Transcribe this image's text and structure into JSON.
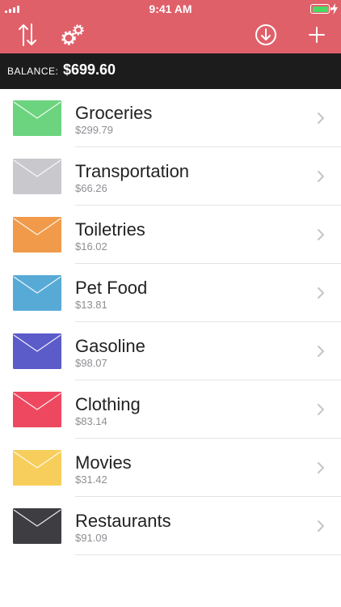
{
  "status": {
    "time": "9:41 AM"
  },
  "nav": {
    "sort_icon": "sort-arrows-icon",
    "settings_icon": "gears-icon",
    "download_icon": "download-circle-icon",
    "add_icon": "plus-icon"
  },
  "colors": {
    "nav_bg": "#E0606A",
    "balance_bg": "#1C1C1C",
    "battery": "#4CD964"
  },
  "balance": {
    "label": "BALANCE:",
    "amount": "$699.60"
  },
  "envelopes": [
    {
      "name": "Groceries",
      "amount": "$299.79",
      "color": "#6CD47F"
    },
    {
      "name": "Transportation",
      "amount": "$66.26",
      "color": "#C8C8CD"
    },
    {
      "name": "Toiletries",
      "amount": "$16.02",
      "color": "#F09A4A"
    },
    {
      "name": "Pet Food",
      "amount": "$13.81",
      "color": "#58AAD6"
    },
    {
      "name": "Gasoline",
      "amount": "$98.07",
      "color": "#5B5BC9"
    },
    {
      "name": "Clothing",
      "amount": "$83.14",
      "color": "#EE4860"
    },
    {
      "name": "Movies",
      "amount": "$31.42",
      "color": "#F7CE5B"
    },
    {
      "name": "Restaurants",
      "amount": "$91.09",
      "color": "#3E3E42"
    }
  ]
}
